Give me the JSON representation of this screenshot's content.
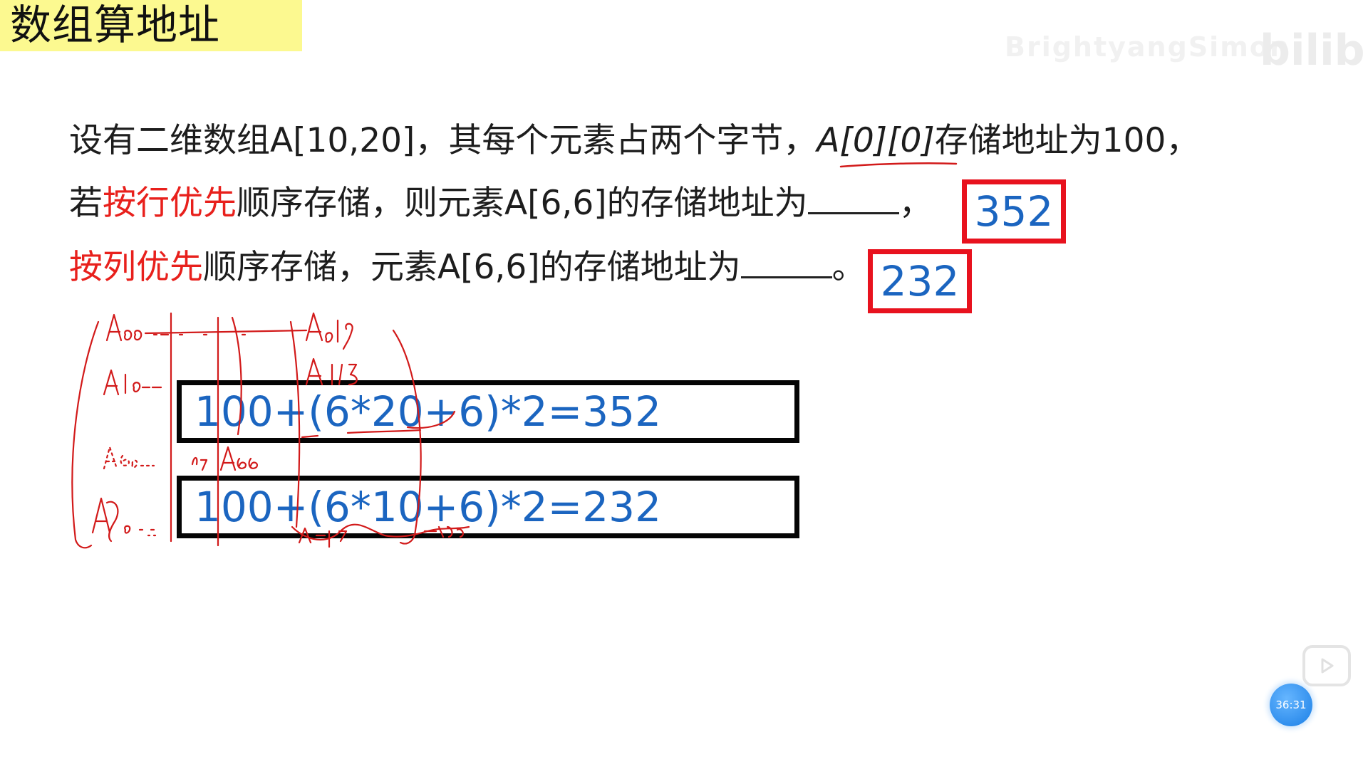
{
  "title": "数组算地址",
  "watermark": {
    "text": "BrightyangSimon",
    "logo": "bilibili"
  },
  "question": {
    "line1": "设有二维数组A[10,20]，其每个元素占两个字节，",
    "line1_ref": "A[0][0]",
    "line1_tail": "存储地址为100，",
    "line2_pre": "若",
    "line2_red": "按行优先",
    "line2_post": "顺序存储，则元素A[6,6]的存储地址为",
    "line2_end": "，",
    "line3_red": "按列优先",
    "line3_post": "顺序存储，元素A[6,6]的存储地址为",
    "line3_end": "。"
  },
  "answers": {
    "row_major": "352",
    "col_major": "232"
  },
  "formulas": {
    "row_major": "100+(6*20+6)*2=352",
    "col_major": "100+(6*10+6)*2=232"
  },
  "player": {
    "time": "36:31",
    "play_icon": "play-icon"
  },
  "colors": {
    "highlight": "#fcf990",
    "red": "#e8201c",
    "blue": "#1b65c0"
  }
}
